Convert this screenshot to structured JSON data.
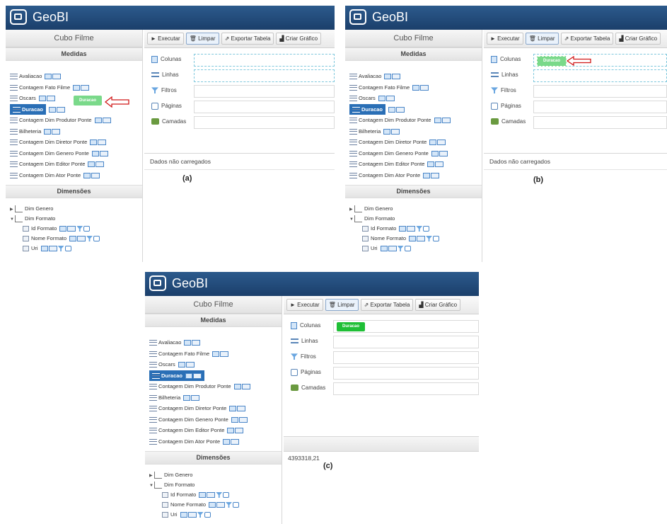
{
  "app": {
    "title": "GeoBI"
  },
  "cube": {
    "title": "Cubo Filme"
  },
  "sections": {
    "measures": "Medidas",
    "dimensions": "Dimensões"
  },
  "measures": [
    "Avaliacao",
    "Contagem Fato Filme",
    "Oscars",
    "Duracao",
    "Contagem Dim Produtor Ponte",
    "Bilheteria",
    "Contagem Dim Diretor Ponte",
    "Contagem Dim Genero Ponte",
    "Contagem Dim Editor Ponte",
    "Contagem Dim Ator Ponte"
  ],
  "dimensions": {
    "genre": "Dim Genero",
    "format": "Dim Formato",
    "levels": [
      "Id Formato",
      "Nome Formato",
      "Uri"
    ]
  },
  "toolbar": {
    "execute": "► Executar",
    "clear": "Limpar",
    "export": "Exportar Tabela",
    "chart": "Criar Gráfico"
  },
  "axes": {
    "columns": "Colunas",
    "rows": "Linhas",
    "filters": "Filtros",
    "pages": "Páginas",
    "layers": "Camadas"
  },
  "drag_chip": "Duracao",
  "status": {
    "not_loaded": "Dados não carregados"
  },
  "result": {
    "value": "4393318,21"
  },
  "captions": {
    "a": "(a)",
    "b": "(b)",
    "c": "(c)"
  },
  "colors": {
    "header": "#1f4a7a",
    "selected": "#2a6fb6",
    "chip": "#1fbf36",
    "arrow": "#d01818"
  }
}
